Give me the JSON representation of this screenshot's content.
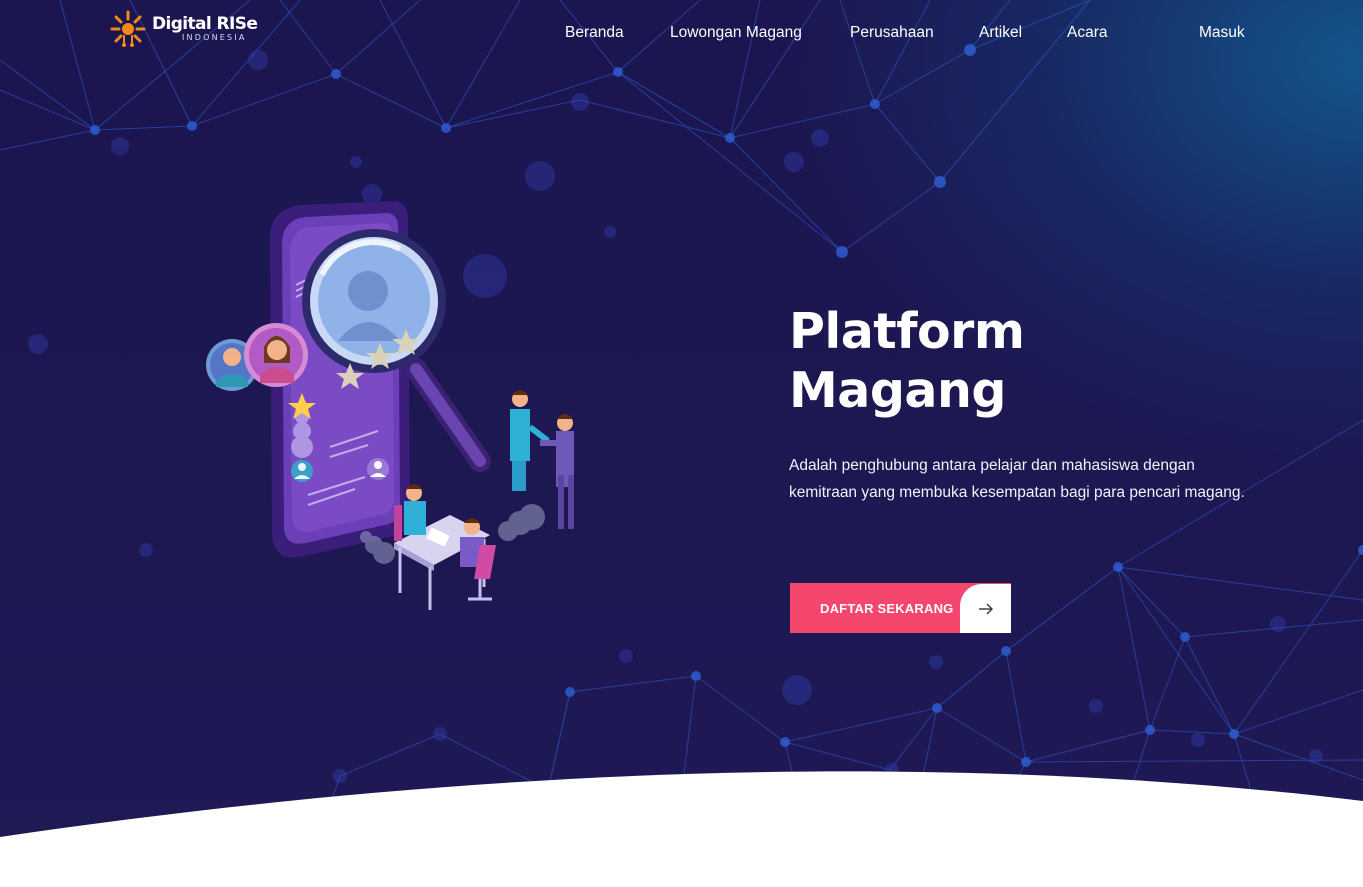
{
  "header": {
    "logo": {
      "title": "Digital RISe",
      "subtitle": "INDONESIA",
      "icon": "sun-circuit-logo-icon"
    },
    "nav": [
      {
        "label": "Beranda"
      },
      {
        "label": "Lowongan Magang"
      },
      {
        "label": "Perusahaan"
      },
      {
        "label": "Artikel"
      },
      {
        "label": "Acara"
      },
      {
        "label": "Masuk"
      }
    ]
  },
  "hero": {
    "title_line1": "Platform",
    "title_line2": "Magang",
    "description": "Adalah penghubung antara pelajar dan mahasiswa dengan kemitraan yang membuka kesempatan bagi para pencari magang.",
    "cta": {
      "label": "DAFTAR SEKARANG",
      "icon": "arrow-right-icon"
    },
    "illustration": "recruitment-search-illustration"
  },
  "colors": {
    "background": "#1d1752",
    "background_glow": "#126096",
    "accent": "#f5476d",
    "network_lines": "#2f5fd6",
    "logo_orange": "#f28a1b",
    "text": "#ffffff"
  }
}
